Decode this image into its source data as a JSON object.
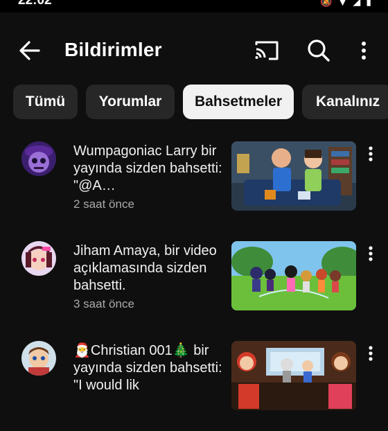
{
  "status": {
    "time": "22:02"
  },
  "header": {
    "title": "Bildirimler"
  },
  "chips": [
    "Tümü",
    "Yorumlar",
    "Bahsetmeler",
    "Kanalınız"
  ],
  "notifications": [
    {
      "message": "Wumpagoniac Larry bir yayında sizden bahsetti: \"@A…",
      "time": "2 saat önce"
    },
    {
      "message": "Jiham Amaya, bir video açıklamasında sizden bahsetti.",
      "time": "3 saat önce"
    },
    {
      "message": "🎅Christian 001🎄 bir yayında sizden bahsetti: \"I would lik",
      "time": ""
    }
  ]
}
